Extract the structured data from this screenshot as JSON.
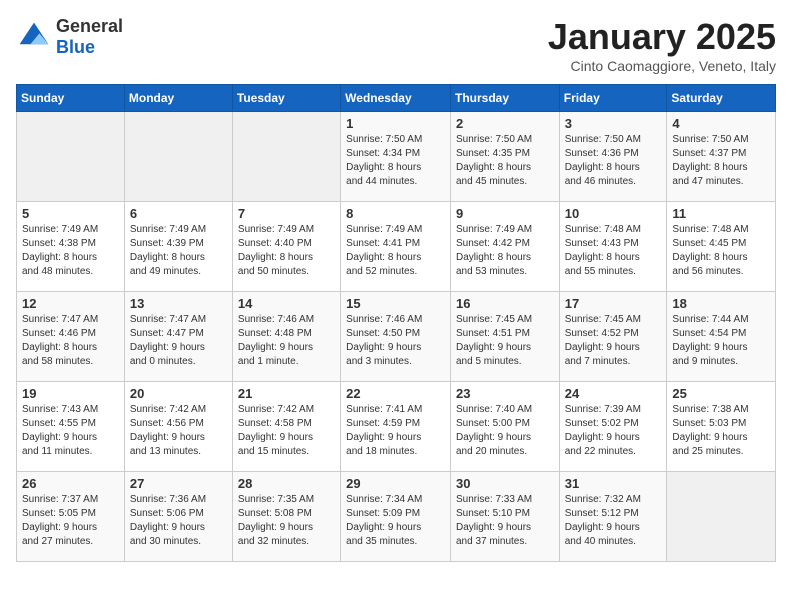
{
  "header": {
    "logo_general": "General",
    "logo_blue": "Blue",
    "title": "January 2025",
    "subtitle": "Cinto Caomaggiore, Veneto, Italy"
  },
  "weekdays": [
    "Sunday",
    "Monday",
    "Tuesday",
    "Wednesday",
    "Thursday",
    "Friday",
    "Saturday"
  ],
  "weeks": [
    [
      {
        "day": "",
        "info": ""
      },
      {
        "day": "",
        "info": ""
      },
      {
        "day": "",
        "info": ""
      },
      {
        "day": "1",
        "info": "Sunrise: 7:50 AM\nSunset: 4:34 PM\nDaylight: 8 hours\nand 44 minutes."
      },
      {
        "day": "2",
        "info": "Sunrise: 7:50 AM\nSunset: 4:35 PM\nDaylight: 8 hours\nand 45 minutes."
      },
      {
        "day": "3",
        "info": "Sunrise: 7:50 AM\nSunset: 4:36 PM\nDaylight: 8 hours\nand 46 minutes."
      },
      {
        "day": "4",
        "info": "Sunrise: 7:50 AM\nSunset: 4:37 PM\nDaylight: 8 hours\nand 47 minutes."
      }
    ],
    [
      {
        "day": "5",
        "info": "Sunrise: 7:49 AM\nSunset: 4:38 PM\nDaylight: 8 hours\nand 48 minutes."
      },
      {
        "day": "6",
        "info": "Sunrise: 7:49 AM\nSunset: 4:39 PM\nDaylight: 8 hours\nand 49 minutes."
      },
      {
        "day": "7",
        "info": "Sunrise: 7:49 AM\nSunset: 4:40 PM\nDaylight: 8 hours\nand 50 minutes."
      },
      {
        "day": "8",
        "info": "Sunrise: 7:49 AM\nSunset: 4:41 PM\nDaylight: 8 hours\nand 52 minutes."
      },
      {
        "day": "9",
        "info": "Sunrise: 7:49 AM\nSunset: 4:42 PM\nDaylight: 8 hours\nand 53 minutes."
      },
      {
        "day": "10",
        "info": "Sunrise: 7:48 AM\nSunset: 4:43 PM\nDaylight: 8 hours\nand 55 minutes."
      },
      {
        "day": "11",
        "info": "Sunrise: 7:48 AM\nSunset: 4:45 PM\nDaylight: 8 hours\nand 56 minutes."
      }
    ],
    [
      {
        "day": "12",
        "info": "Sunrise: 7:47 AM\nSunset: 4:46 PM\nDaylight: 8 hours\nand 58 minutes."
      },
      {
        "day": "13",
        "info": "Sunrise: 7:47 AM\nSunset: 4:47 PM\nDaylight: 9 hours\nand 0 minutes."
      },
      {
        "day": "14",
        "info": "Sunrise: 7:46 AM\nSunset: 4:48 PM\nDaylight: 9 hours\nand 1 minute."
      },
      {
        "day": "15",
        "info": "Sunrise: 7:46 AM\nSunset: 4:50 PM\nDaylight: 9 hours\nand 3 minutes."
      },
      {
        "day": "16",
        "info": "Sunrise: 7:45 AM\nSunset: 4:51 PM\nDaylight: 9 hours\nand 5 minutes."
      },
      {
        "day": "17",
        "info": "Sunrise: 7:45 AM\nSunset: 4:52 PM\nDaylight: 9 hours\nand 7 minutes."
      },
      {
        "day": "18",
        "info": "Sunrise: 7:44 AM\nSunset: 4:54 PM\nDaylight: 9 hours\nand 9 minutes."
      }
    ],
    [
      {
        "day": "19",
        "info": "Sunrise: 7:43 AM\nSunset: 4:55 PM\nDaylight: 9 hours\nand 11 minutes."
      },
      {
        "day": "20",
        "info": "Sunrise: 7:42 AM\nSunset: 4:56 PM\nDaylight: 9 hours\nand 13 minutes."
      },
      {
        "day": "21",
        "info": "Sunrise: 7:42 AM\nSunset: 4:58 PM\nDaylight: 9 hours\nand 15 minutes."
      },
      {
        "day": "22",
        "info": "Sunrise: 7:41 AM\nSunset: 4:59 PM\nDaylight: 9 hours\nand 18 minutes."
      },
      {
        "day": "23",
        "info": "Sunrise: 7:40 AM\nSunset: 5:00 PM\nDaylight: 9 hours\nand 20 minutes."
      },
      {
        "day": "24",
        "info": "Sunrise: 7:39 AM\nSunset: 5:02 PM\nDaylight: 9 hours\nand 22 minutes."
      },
      {
        "day": "25",
        "info": "Sunrise: 7:38 AM\nSunset: 5:03 PM\nDaylight: 9 hours\nand 25 minutes."
      }
    ],
    [
      {
        "day": "26",
        "info": "Sunrise: 7:37 AM\nSunset: 5:05 PM\nDaylight: 9 hours\nand 27 minutes."
      },
      {
        "day": "27",
        "info": "Sunrise: 7:36 AM\nSunset: 5:06 PM\nDaylight: 9 hours\nand 30 minutes."
      },
      {
        "day": "28",
        "info": "Sunrise: 7:35 AM\nSunset: 5:08 PM\nDaylight: 9 hours\nand 32 minutes."
      },
      {
        "day": "29",
        "info": "Sunrise: 7:34 AM\nSunset: 5:09 PM\nDaylight: 9 hours\nand 35 minutes."
      },
      {
        "day": "30",
        "info": "Sunrise: 7:33 AM\nSunset: 5:10 PM\nDaylight: 9 hours\nand 37 minutes."
      },
      {
        "day": "31",
        "info": "Sunrise: 7:32 AM\nSunset: 5:12 PM\nDaylight: 9 hours\nand 40 minutes."
      },
      {
        "day": "",
        "info": ""
      }
    ]
  ]
}
